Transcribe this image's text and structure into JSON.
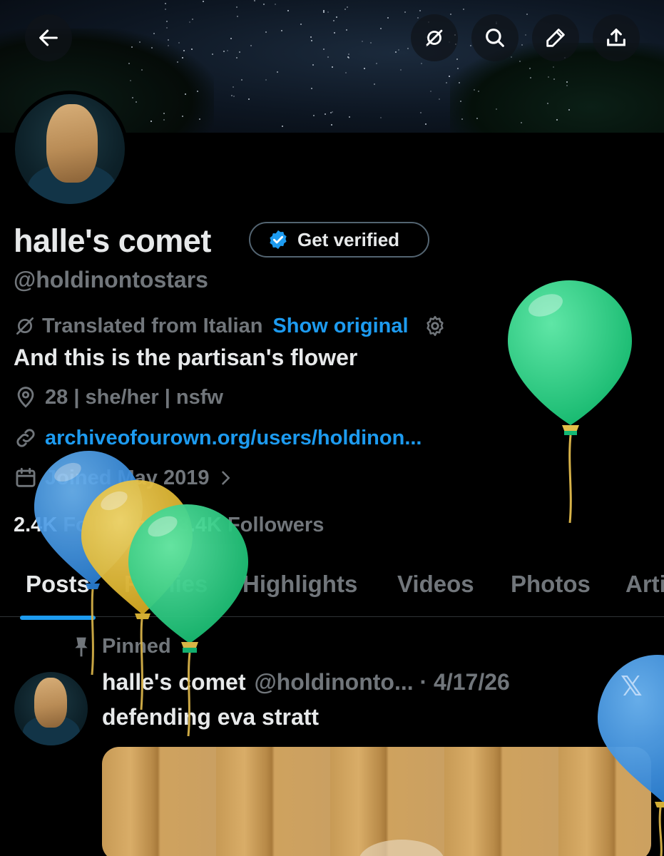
{
  "header": {
    "back_icon": "arrow-left-icon",
    "actions": [
      "translate-icon",
      "search-icon",
      "edit-icon",
      "share-icon"
    ]
  },
  "profile": {
    "display_name": "halle's comet",
    "verify_label": "Get verified",
    "handle": "@holdinontostars",
    "translation": {
      "note": "Translated from Italian",
      "link": "Show original"
    },
    "bio": "And this is the partisan's flower",
    "location": "28 | she/her | nsfw",
    "website": "archiveofourown.org/users/holdinon...",
    "joined": "Joined May 2019",
    "following_count": "2.4K",
    "following_label": "Following",
    "followers_count": "3.4K",
    "followers_label": "Followers"
  },
  "tabs": [
    {
      "label": "Posts"
    },
    {
      "label": "Replies"
    },
    {
      "label": "Highlights"
    },
    {
      "label": "Videos"
    },
    {
      "label": "Photos"
    },
    {
      "label": "Articles"
    }
  ],
  "post": {
    "pinned_label": "Pinned",
    "author": "halle's comet",
    "meta": "@holdinonto... · 4/17/26",
    "text": "defending eva stratt"
  },
  "colors": {
    "accent": "#1d9bf0",
    "muted": "#71767b",
    "text": "#e7e9ea",
    "balloon_green": "#2fd08a",
    "balloon_yellow": "#e9c23a",
    "balloon_blue": "#3d95e6"
  }
}
